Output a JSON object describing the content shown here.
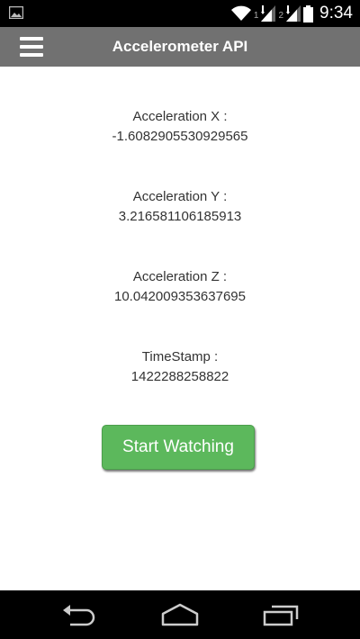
{
  "status_bar": {
    "sim1": "1",
    "sim2": "2",
    "time": "9:34"
  },
  "app_bar": {
    "title": "Accelerometer API"
  },
  "readings": {
    "x": {
      "label": "Acceleration X :",
      "value": "-1.6082905530929565"
    },
    "y": {
      "label": "Acceleration Y :",
      "value": "3.216581106185913"
    },
    "z": {
      "label": "Acceleration Z :",
      "value": "10.042009353637695"
    },
    "timestamp": {
      "label": "TimeStamp :",
      "value": "1422288258822"
    }
  },
  "actions": {
    "start_label": "Start Watching"
  },
  "colors": {
    "app_bar": "#717171",
    "button": "#5cb85c"
  },
  "icons": {
    "status_left": "image-notification-icon",
    "wifi": "wifi-icon",
    "signal": "signal-icon",
    "battery": "battery-icon",
    "menu": "hamburger-menu-icon",
    "back": "back-icon",
    "home": "home-icon",
    "recents": "recent-apps-icon"
  }
}
